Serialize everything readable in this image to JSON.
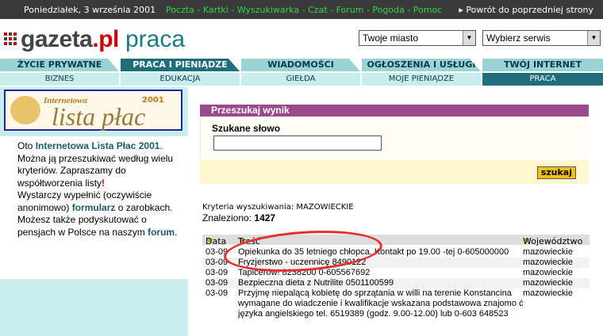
{
  "topbar": {
    "date": "Poniedziałek, 3 września 2001",
    "links": [
      "Poczta",
      "Kartki",
      "Wyszukiwarka",
      "Czat",
      "Forum",
      "Pogoda",
      "Pomoc"
    ],
    "back": "▸ Powrót do poprzedniej strony"
  },
  "logo": {
    "name": "gazeta",
    "tld": ".pl",
    "section": "praca"
  },
  "selects": {
    "city": "Twoje miasto",
    "service": "Wybierz serwis"
  },
  "nav1": [
    "ŻYCIE PRYWATNE",
    "PRACA I PIENIĄDZE",
    "WIADOMOŚCI",
    "OGŁOSZENIA I USŁUGI",
    "TWÓJ INTERNET"
  ],
  "nav2": [
    "BIZNES",
    "EDUKACJA",
    "GIEŁDA",
    "MOJE PIENIĄDZE",
    "PRACA"
  ],
  "banner": {
    "line1": "Internetowa",
    "line2": "lista płac",
    "year": "2001"
  },
  "left": {
    "intro": "Oto",
    "link1": "Internetowa Lista Płac 2001",
    "text1": ". Można ją przeszukiwać według wielu kryteriów. Zapraszamy do współtworzenia listy",
    "excl": "!",
    "text2": "Wystarczy wypełnić (oczywiście anonimowo)",
    "link2": "formularz",
    "text3": "o zarobkach.",
    "text4": "Możesz także podyskutować o pensjach w Polsce na naszym",
    "link3": "forum",
    "dot": "."
  },
  "search": {
    "title": "Przeszukaj wynik",
    "label": "Szukane słowo",
    "value": "",
    "button": "szukaj",
    "criteria": "Kryteria wyszukiwania: MAZOWIECKIE",
    "found_label": "Znaleziono:",
    "found_count": "1427"
  },
  "results": {
    "headers": [
      "Data",
      "Treść",
      "Województwo"
    ],
    "rows": [
      {
        "date": "03-09",
        "text": "Opiekunka do 35 letniego chłopca. Kontakt po 19.00 -tej 0-605000000",
        "region": "mazowieckie"
      },
      {
        "date": "03-09",
        "text": "Fryzjerstwo - uczennicę 8490122",
        "region": "mazowieckie"
      },
      {
        "date": "03-09",
        "text": "Tapicerów! 8238200 0-605567692",
        "region": "mazowieckie"
      },
      {
        "date": "03-09",
        "text": "Bezpieczna dieta z Nutrilite 0501100599",
        "region": "mazowieckie"
      },
      {
        "date": "03-09",
        "text": "Przyjmę niepalącą kobietę do sprzątania w willi na terenie Konstancina wymagane do wiadczenie i kwalifikacje wskazana podstawowa znajomo ć języka angielskiego tel. 6519389 (godz. 9.00-12.00) lub 0-603 648523",
        "region": "mazowieckie"
      }
    ]
  }
}
